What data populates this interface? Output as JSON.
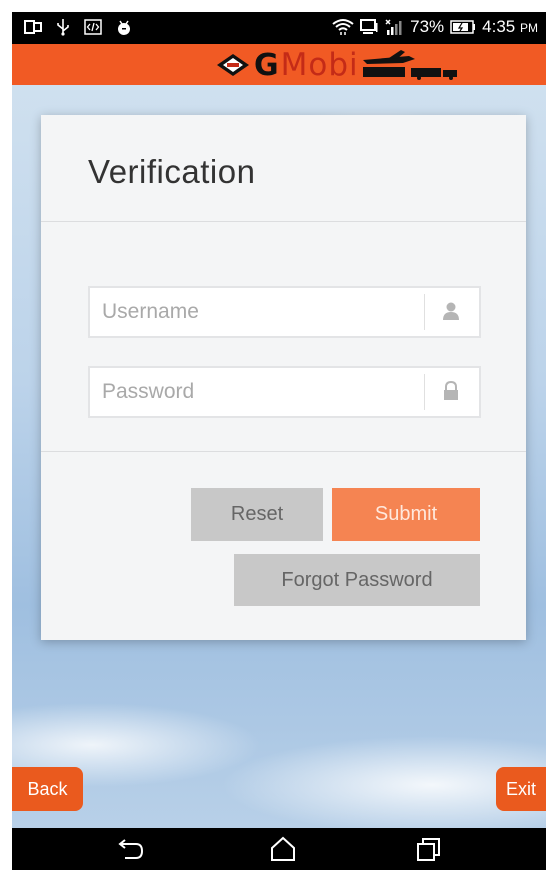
{
  "status_bar": {
    "battery": "73%",
    "time": "4:35",
    "ampm": "PM"
  },
  "header": {
    "logo_letter": "G",
    "logo_text": "Mobi"
  },
  "form": {
    "title": "Verification",
    "username_placeholder": "Username",
    "password_placeholder": "Password",
    "reset_label": "Reset",
    "submit_label": "Submit",
    "forgot_label": "Forgot Password"
  },
  "footer": {
    "back_label": "Back",
    "exit_label": "Exit"
  },
  "colors": {
    "brand_orange": "#f15a24",
    "submit_orange": "#f58452",
    "button_gray": "#c8c8c8"
  },
  "icons": [
    "user-icon",
    "lock-icon",
    "back-nav-icon",
    "home-nav-icon",
    "recents-nav-icon"
  ]
}
